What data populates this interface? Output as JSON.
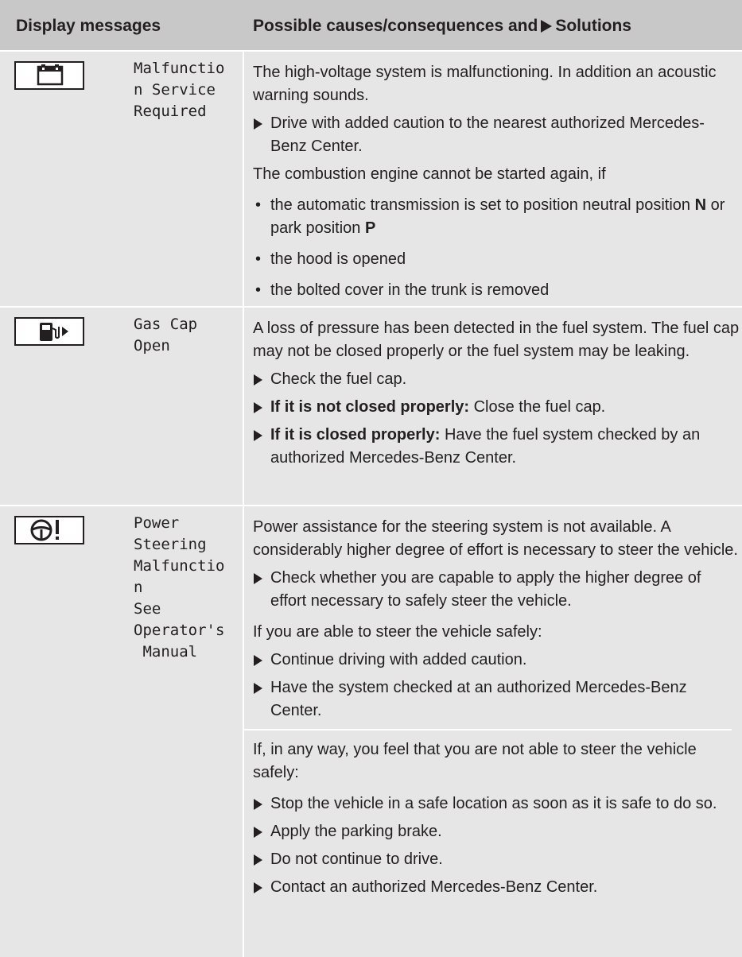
{
  "header": {
    "col1": "Display messages",
    "col2_prefix": "Possible causes/consequences and",
    "col2_suffix": "Solutions"
  },
  "rows": [
    {
      "icon": "high-voltage-battery-icon",
      "message": "Malfunctio\nn Service\nRequired",
      "p1": "The high-voltage system is malfunctioning. In addition an acoustic warning sounds.",
      "s1": "Drive with added caution to the nearest authorized Mercedes-Benz Center.",
      "p2": "The combustion engine cannot be started again, if",
      "b1_pre": "the automatic transmission is set to position neutral position ",
      "b1_n": "N",
      "b1_mid": " or park position ",
      "b1_p": "P",
      "b2": "the hood is opened",
      "b3": "the bolted cover in the trunk is removed"
    },
    {
      "icon": "fuel-pump-icon",
      "message": "Gas Cap\nOpen",
      "p1": "A loss of pressure has been detected in the fuel system. The fuel cap may not be closed properly or the fuel system may be leaking.",
      "s1": "Check the fuel cap.",
      "s2_bold": "If it is not closed properly:",
      "s2_rest": " Close the fuel cap.",
      "s3_bold": "If it is closed properly:",
      "s3_rest": " Have the fuel system checked by an authorized Mercedes-Benz Center."
    },
    {
      "icon": "steering-wheel-warning-icon",
      "message": "Power\nSteering\nMalfunctio\nn\nSee\nOperator's\n Manual",
      "p1": "Power assistance for the steering system is not available. A considerably higher degree of effort is necessary to steer the vehicle.",
      "s1": "Check whether you are capable to apply the higher degree of effort necessary to safely steer the vehicle.",
      "p2": "If you are able to steer the vehicle safely:",
      "s2": "Continue driving with added caution.",
      "s3": "Have the system checked at an authorized Mercedes-Benz Center.",
      "p3": "If, in any way, you feel that you are not able to steer the vehicle safely:",
      "s4": "Stop the vehicle in a safe location as soon as it is safe to do so.",
      "s5": "Apply the parking brake.",
      "s6": "Do not continue to drive.",
      "s7": "Contact an authorized Mercedes-Benz Center."
    }
  ]
}
